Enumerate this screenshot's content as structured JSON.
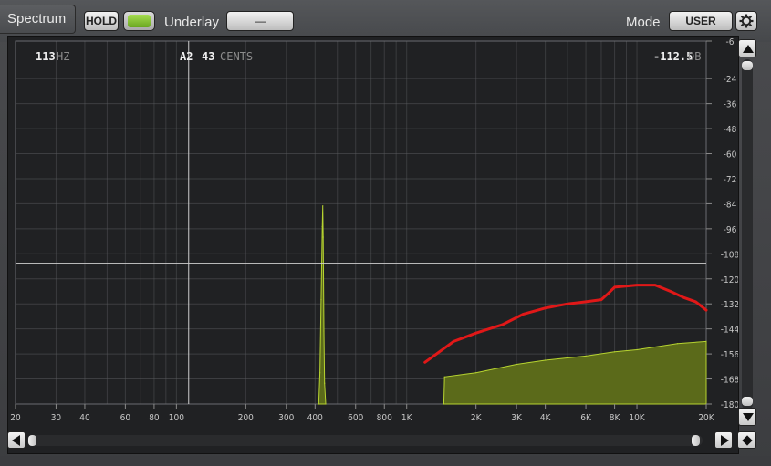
{
  "toolbar": {
    "tab_label": "Spectrum",
    "hold_label": "HOLD",
    "underlay_label": "Underlay",
    "underlay_value": "—",
    "mode_label": "Mode",
    "mode_value": "USER"
  },
  "readouts": {
    "freq_value": "113",
    "freq_unit": "HZ",
    "note": "A2",
    "cents_value": "43",
    "cents_unit": "CENTS",
    "level_value": "-112.5",
    "level_unit": "DB"
  },
  "icons": {
    "settings": "gear-icon",
    "scroll_up": "arrow-up-icon",
    "scroll_down": "arrow-down-icon",
    "scroll_left": "arrow-left-icon",
    "scroll_right": "arrow-right-icon",
    "zoom": "diamond-icon"
  },
  "colors": {
    "spectrum_fill": "#5b6a1a",
    "spectrum_line": "#b7d430",
    "annotation": "#e01818",
    "grid": "#5a5c5f"
  },
  "chart_data": {
    "type": "area",
    "title": "",
    "xlabel": "",
    "ylabel": "",
    "x_scale": "log",
    "xlim": [
      20,
      20000
    ],
    "ylim": [
      -180,
      -6
    ],
    "x_tick_labels": [
      {
        "value": 20,
        "label": "20"
      },
      {
        "value": 30,
        "label": "30"
      },
      {
        "value": 40,
        "label": "40"
      },
      {
        "value": 60,
        "label": "60"
      },
      {
        "value": 80,
        "label": "80"
      },
      {
        "value": 100,
        "label": "100"
      },
      {
        "value": 200,
        "label": "200"
      },
      {
        "value": 300,
        "label": "300"
      },
      {
        "value": 400,
        "label": "400"
      },
      {
        "value": 600,
        "label": "600"
      },
      {
        "value": 800,
        "label": "800"
      },
      {
        "value": 1000,
        "label": "1K"
      },
      {
        "value": 2000,
        "label": "2K"
      },
      {
        "value": 3000,
        "label": "3K"
      },
      {
        "value": 4000,
        "label": "4K"
      },
      {
        "value": 6000,
        "label": "6K"
      },
      {
        "value": 8000,
        "label": "8K"
      },
      {
        "value": 10000,
        "label": "10K"
      },
      {
        "value": 20000,
        "label": "20K"
      }
    ],
    "y_tick_labels": [
      {
        "value": -6,
        "label": "-6"
      },
      {
        "value": -24,
        "label": "-24"
      },
      {
        "value": -36,
        "label": "-36"
      },
      {
        "value": -48,
        "label": "-48"
      },
      {
        "value": -60,
        "label": "-60"
      },
      {
        "value": -72,
        "label": "-72"
      },
      {
        "value": -84,
        "label": "-84"
      },
      {
        "value": -96,
        "label": "-96"
      },
      {
        "value": -108,
        "label": "-108"
      },
      {
        "value": -120,
        "label": "-120"
      },
      {
        "value": -132,
        "label": "-132"
      },
      {
        "value": -144,
        "label": "-144"
      },
      {
        "value": -156,
        "label": "-156"
      },
      {
        "value": -168,
        "label": "-168"
      },
      {
        "value": -180,
        "label": "-180"
      }
    ],
    "cursor": {
      "x": 113,
      "y": -112.5
    },
    "series": [
      {
        "kind": "spectrum",
        "points": [
          [
            415,
            -180
          ],
          [
            420,
            -165
          ],
          [
            425,
            -130
          ],
          [
            430,
            -95
          ],
          [
            432,
            -85
          ],
          [
            434,
            -100
          ],
          [
            437,
            -145
          ],
          [
            440,
            -170
          ],
          [
            445,
            -180
          ],
          [
            1450,
            -180
          ],
          [
            1460,
            -167
          ],
          [
            2000,
            -165
          ],
          [
            3000,
            -161
          ],
          [
            4000,
            -159
          ],
          [
            6000,
            -157
          ],
          [
            8000,
            -155
          ],
          [
            10000,
            -154
          ],
          [
            15000,
            -151
          ],
          [
            20000,
            -150
          ]
        ]
      },
      {
        "kind": "annotation",
        "points": [
          [
            1200,
            -160
          ],
          [
            1600,
            -150
          ],
          [
            2000,
            -146
          ],
          [
            2600,
            -142
          ],
          [
            3200,
            -137
          ],
          [
            4000,
            -134
          ],
          [
            5000,
            -132
          ],
          [
            6000,
            -131
          ],
          [
            7000,
            -130
          ],
          [
            7500,
            -127
          ],
          [
            8000,
            -124
          ],
          [
            10000,
            -123
          ],
          [
            12000,
            -123
          ],
          [
            14000,
            -126
          ],
          [
            16000,
            -129
          ],
          [
            18000,
            -131
          ],
          [
            20000,
            -135
          ]
        ]
      }
    ]
  }
}
